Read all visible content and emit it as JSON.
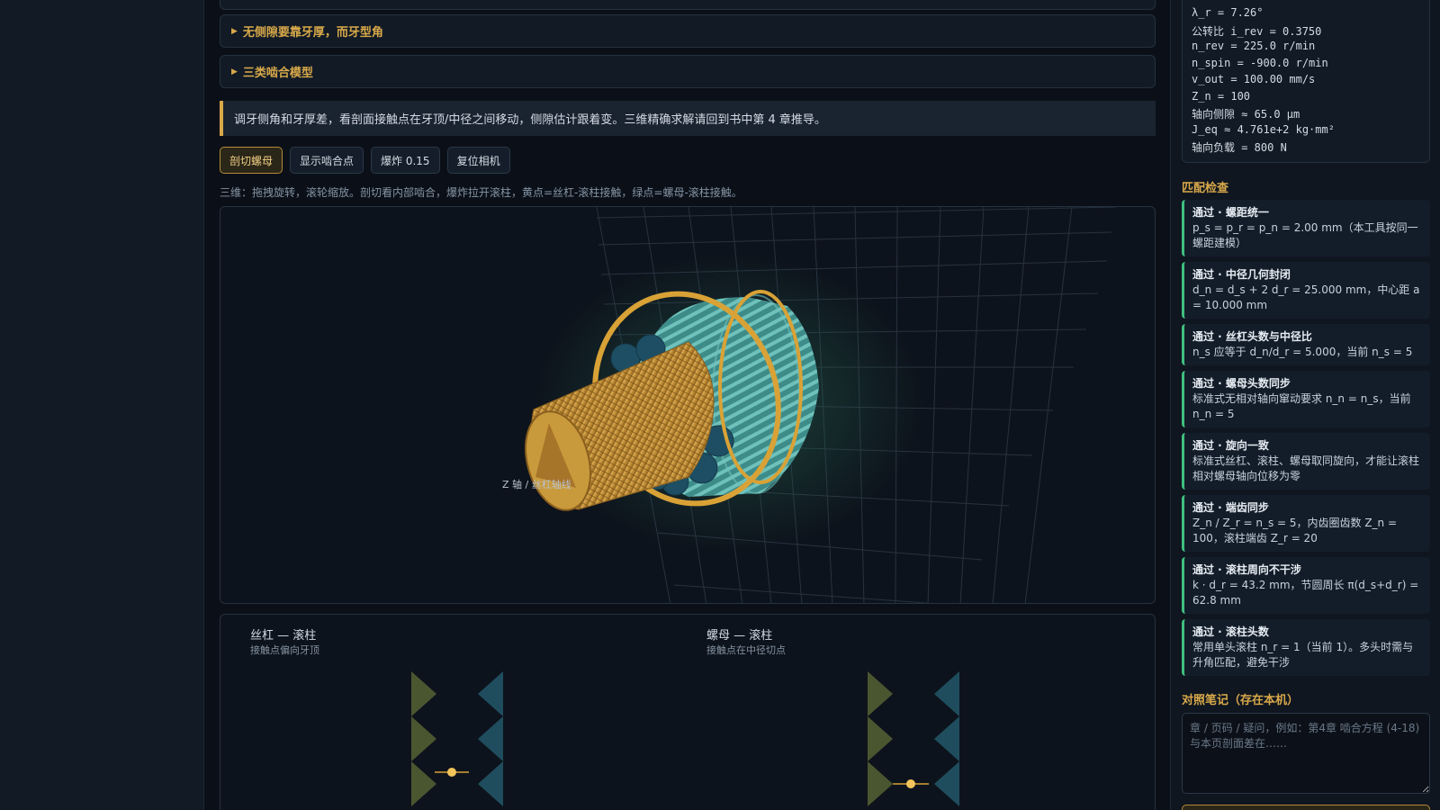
{
  "accordions": [
    {
      "label": ""
    },
    {
      "label": "无侧隙要靠牙厚，而牙型角"
    },
    {
      "label": "三类啮合模型"
    }
  ],
  "note": "调牙侧角和牙厚差，看剖面接触点在牙顶/中径之间移动，侧隙估计跟着变。三维精确求解请回到书中第 4 章推导。",
  "toolbar": {
    "buttons": [
      {
        "label": "剖切螺母",
        "active": true
      },
      {
        "label": "显示啮合点",
        "active": false
      },
      {
        "label": "爆炸 0.15",
        "active": false
      },
      {
        "label": "复位相机",
        "active": false
      }
    ]
  },
  "hint": "三维：拖拽旋转，滚轮缩放。剖切看内部啮合，爆炸拉开滚柱，黄点=丝杠-滚柱接触，绿点=螺母-滚柱接触。",
  "viewport": {
    "axis_label": "Z 轴 / 丝杠轴线"
  },
  "contacts": [
    {
      "title": "丝杠 — 滚柱",
      "subtitle": "接触点偏向牙顶"
    },
    {
      "title": "螺母 — 滚柱",
      "subtitle": "接触点在中径切点"
    }
  ],
  "params": [
    "λ_r = 7.26°",
    "公转比 i_rev = 0.3750",
    "n_rev = 225.0 r/min",
    "n_spin = -900.0 r/min",
    "v_out = 100.00 mm/s",
    "Z_n = 100",
    "轴向侧隙 ≈ 65.0 μm",
    "J_eq ≈ 4.761e+2 kg·mm²",
    "轴向负载 = 800 N"
  ],
  "checks_title": "匹配检查",
  "checks": [
    {
      "title": "通过 · 螺距统一",
      "body": "p_s = p_r = p_n = 2.00 mm（本工具按同一螺距建模）"
    },
    {
      "title": "通过 · 中径几何封闭",
      "body": "d_n = d_s + 2 d_r = 25.000 mm，中心距 a = 10.000 mm"
    },
    {
      "title": "通过 · 丝杠头数与中径比",
      "body": "n_s 应等于 d_n/d_r = 5.000，当前 n_s = 5"
    },
    {
      "title": "通过 · 螺母头数同步",
      "body": "标准式无相对轴向窜动要求 n_n = n_s，当前 n_n = 5"
    },
    {
      "title": "通过 · 旋向一致",
      "body": "标准式丝杠、滚柱、螺母取同旋向，才能让滚柱相对螺母轴向位移为零"
    },
    {
      "title": "通过 · 端齿同步",
      "body": "Z_n / Z_r = n_s = 5，内齿圈齿数 Z_n = 100，滚柱端齿 Z_r = 20"
    },
    {
      "title": "通过 · 滚柱周向不干涉",
      "body": "k · d_r = 43.2 mm，节圆周长 π(d_s+d_r) = 62.8 mm"
    },
    {
      "title": "通过 · 滚柱头数",
      "body": "常用单头滚柱 n_r = 1（当前 1）。多头时需与升角匹配，避免干涉"
    }
  ],
  "notes": {
    "title": "对照笔记（存在本机）",
    "placeholder": "章 / 页码 / 疑问，例如：第4章 啮合方程 (4-18) 与本页剖面差在……"
  },
  "colors": {
    "accent": "#d9a94a",
    "pass": "#3fbf7f",
    "screw": "#c99a3c",
    "roller": "#2f5d73",
    "nut_ring": "#d9a236"
  }
}
